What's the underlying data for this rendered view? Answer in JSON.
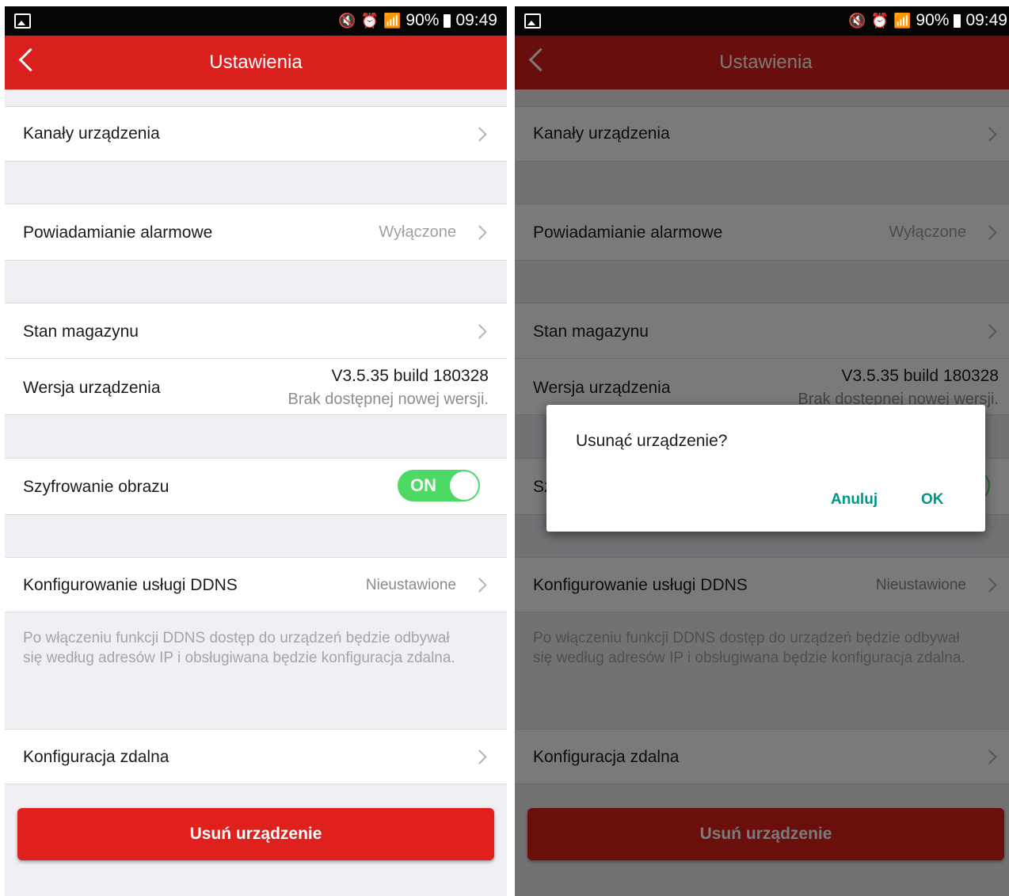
{
  "status_bar": {
    "icons": [
      "gallery-icon",
      "mute-icon",
      "alarm-icon",
      "wifi-icon",
      "signal-icon",
      "battery-icon"
    ],
    "battery": "90%",
    "time": "09:49"
  },
  "header": {
    "title": "Ustawienia"
  },
  "settings": {
    "device_channels": "Kanały urządzenia",
    "alarm_notification": "Powiadamianie alarmowe",
    "alarm_notification_value": "Wyłączone",
    "storage_status": "Stan magazynu",
    "device_version": "Wersja urządzenia",
    "device_version_value": "V3.5.35 build 180328",
    "device_version_note": "Brak dostępnej nowej wersji.",
    "image_encryption": "Szyfrowanie obrazu",
    "image_encryption_toggle": "ON",
    "ddns_config": "Konfigurowanie usługi DDNS",
    "ddns_value": "Nieustawione",
    "ddns_note": "Po włączeniu funkcji DDNS dostęp do urządzeń będzie odbywał się według adresów IP i obsługiwana będzie konfiguracja zdalna.",
    "remote_config": "Konfiguracja zdalna",
    "delete_button": "Usuń urządzenie"
  },
  "dialog": {
    "message": "Usunąć urządzenie?",
    "cancel": "Anuluj",
    "ok": "OK"
  },
  "colors": {
    "brand_red": "#d9201d",
    "toggle_green": "#4cd964",
    "dialog_accent": "#009688"
  }
}
